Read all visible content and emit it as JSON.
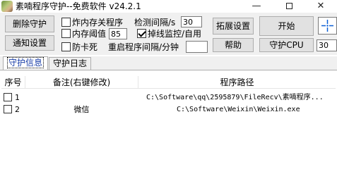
{
  "window": {
    "title": "素喃程序守护--免费软件  v24.2.1",
    "minimize": "—",
    "close": "✕"
  },
  "toolbar": {
    "delete_guard": "删除守护",
    "notify_settings": "通知设置",
    "mem_restart_label": "炸内存关程序",
    "mem_threshold_label": "内存阈值",
    "mem_threshold_value": "85",
    "anti_freeze_label": "防卡死",
    "check_interval_label": "检测间隔/s",
    "check_interval_value": "30",
    "offline_monitor_label": "掉线监控/自用",
    "restart_interval_label": "重启程序间隔/分钟",
    "restart_interval_value": "",
    "extend_settings": "拓展设置",
    "help": "帮助",
    "start": "开始",
    "guard_cpu": "守护CPU",
    "cpu_value": "30",
    "target_icon": "crosshair-icon"
  },
  "tabs": [
    {
      "label": "守护信息",
      "active": true
    },
    {
      "label": "守护日志",
      "active": false
    }
  ],
  "table": {
    "columns": [
      "序号",
      "备注(右键修改)",
      "程序路径"
    ],
    "rows": [
      {
        "index": "1",
        "note": "",
        "path": "C:\\Software\\qq\\2595879\\FileRecv\\素喃程序..."
      },
      {
        "index": "2",
        "note": "微信",
        "path": "C:\\Software\\Weixin\\Weixin.exe"
      }
    ]
  }
}
